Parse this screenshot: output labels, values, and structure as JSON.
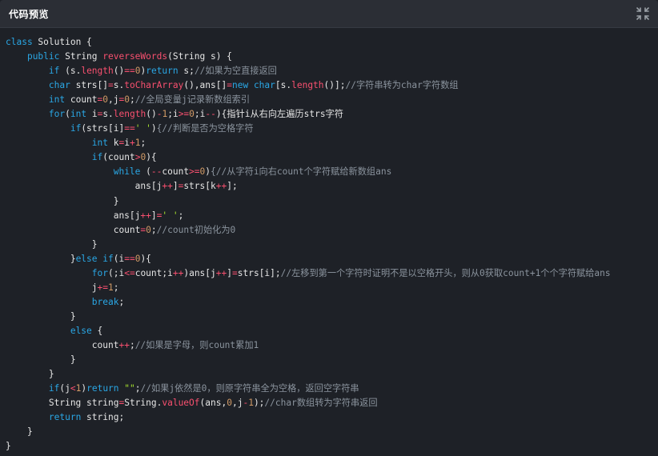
{
  "header": {
    "title": "代码预览",
    "collapse_icon": "collapse-icon"
  },
  "theme": {
    "background": "#1e2127",
    "titlebar": "#2b2e35",
    "keyword": "#2aa7e5",
    "function": "#f9506f",
    "number": "#d19a66",
    "string": "#a6e22e",
    "comment": "#8b949e",
    "text": "#e6e6e6"
  },
  "code": {
    "language": "java",
    "lines": [
      [
        [
          "kw",
          "class"
        ],
        [
          "tx",
          " Solution {"
        ]
      ],
      [
        [
          "tx",
          "    "
        ],
        [
          "kw",
          "public"
        ],
        [
          "tx",
          " String "
        ],
        [
          "fn",
          "reverseWords"
        ],
        [
          "tx",
          "(String s) {"
        ]
      ],
      [
        [
          "tx",
          "        "
        ],
        [
          "kw",
          "if"
        ],
        [
          "tx",
          " (s."
        ],
        [
          "fn",
          "length"
        ],
        [
          "tx",
          "()"
        ],
        [
          "op",
          "=="
        ],
        [
          "num",
          "0"
        ],
        [
          "tx",
          ")"
        ],
        [
          "kw",
          "return"
        ],
        [
          "tx",
          " s;"
        ],
        [
          "cm",
          "//如果为空直接返回"
        ]
      ],
      [
        [
          "tx",
          "        "
        ],
        [
          "kw",
          "char"
        ],
        [
          "tx",
          " strs[]"
        ],
        [
          "op",
          "="
        ],
        [
          "tx",
          "s."
        ],
        [
          "fn",
          "toCharArray"
        ],
        [
          "tx",
          "(),ans[]"
        ],
        [
          "op",
          "="
        ],
        [
          "kw",
          "new"
        ],
        [
          "tx",
          " "
        ],
        [
          "kw",
          "char"
        ],
        [
          "tx",
          "[s."
        ],
        [
          "fn",
          "length"
        ],
        [
          "tx",
          "()];"
        ],
        [
          "cm",
          "//字符串转为char字符数组"
        ]
      ],
      [
        [
          "tx",
          "        "
        ],
        [
          "kw",
          "int"
        ],
        [
          "tx",
          " count"
        ],
        [
          "op",
          "="
        ],
        [
          "num",
          "0"
        ],
        [
          "tx",
          ",j"
        ],
        [
          "op",
          "="
        ],
        [
          "num",
          "0"
        ],
        [
          "tx",
          ";"
        ],
        [
          "cm",
          "//全局变量j记录新数组索引"
        ]
      ],
      [
        [
          "tx",
          "        "
        ],
        [
          "kw",
          "for"
        ],
        [
          "tx",
          "("
        ],
        [
          "kw",
          "int"
        ],
        [
          "tx",
          " i"
        ],
        [
          "op",
          "="
        ],
        [
          "tx",
          "s."
        ],
        [
          "fn",
          "length"
        ],
        [
          "tx",
          "()"
        ],
        [
          "op",
          "-"
        ],
        [
          "num",
          "1"
        ],
        [
          "tx",
          ";i"
        ],
        [
          "op",
          ">="
        ],
        [
          "num",
          "0"
        ],
        [
          "tx",
          ";i"
        ],
        [
          "op",
          "--"
        ],
        [
          "tx",
          ")"
        ],
        [
          "tx",
          "{指针i从右向左遍历strs字符"
        ]
      ],
      [
        [
          "tx",
          "            "
        ],
        [
          "kw",
          "if"
        ],
        [
          "tx",
          "(strs[i]"
        ],
        [
          "op",
          "=="
        ],
        [
          "str",
          "' '"
        ],
        [
          "tx",
          ")"
        ],
        [
          "cm",
          "{//判断是否为空格字符"
        ]
      ],
      [
        [
          "tx",
          "                "
        ],
        [
          "kw",
          "int"
        ],
        [
          "tx",
          " k"
        ],
        [
          "op",
          "="
        ],
        [
          "tx",
          "i"
        ],
        [
          "op",
          "+"
        ],
        [
          "num",
          "1"
        ],
        [
          "tx",
          ";"
        ]
      ],
      [
        [
          "tx",
          "                "
        ],
        [
          "kw",
          "if"
        ],
        [
          "tx",
          "(count"
        ],
        [
          "op",
          ">"
        ],
        [
          "num",
          "0"
        ],
        [
          "tx",
          "){"
        ]
      ],
      [
        [
          "tx",
          "                    "
        ],
        [
          "kw",
          "while"
        ],
        [
          "tx",
          " ("
        ],
        [
          "op",
          "--"
        ],
        [
          "tx",
          "count"
        ],
        [
          "op",
          ">="
        ],
        [
          "num",
          "0"
        ],
        [
          "tx",
          ")"
        ],
        [
          "cm",
          "{//从字符i向右count个字符赋给新数组ans"
        ]
      ],
      [
        [
          "tx",
          "                        ans[j"
        ],
        [
          "op",
          "++"
        ],
        [
          "tx",
          "]"
        ],
        [
          "op",
          "="
        ],
        [
          "tx",
          "strs[k"
        ],
        [
          "op",
          "++"
        ],
        [
          "tx",
          "];"
        ]
      ],
      [
        [
          "tx",
          "                    }"
        ]
      ],
      [
        [
          "tx",
          "                    ans[j"
        ],
        [
          "op",
          "++"
        ],
        [
          "tx",
          "]"
        ],
        [
          "op",
          "="
        ],
        [
          "str",
          "' '"
        ],
        [
          "tx",
          ";"
        ]
      ],
      [
        [
          "tx",
          "                    count"
        ],
        [
          "op",
          "="
        ],
        [
          "num",
          "0"
        ],
        [
          "tx",
          ";"
        ],
        [
          "cm",
          "//count初始化为0"
        ]
      ],
      [
        [
          "tx",
          "                }"
        ]
      ],
      [
        [
          "tx",
          "            }"
        ],
        [
          "kw",
          "else if"
        ],
        [
          "tx",
          "(i"
        ],
        [
          "op",
          "=="
        ],
        [
          "num",
          "0"
        ],
        [
          "tx",
          "){"
        ]
      ],
      [
        [
          "tx",
          "                "
        ],
        [
          "kw",
          "for"
        ],
        [
          "tx",
          "(;i"
        ],
        [
          "op",
          "<="
        ],
        [
          "tx",
          "count;i"
        ],
        [
          "op",
          "++"
        ],
        [
          "tx",
          ")ans[j"
        ],
        [
          "op",
          "++"
        ],
        [
          "tx",
          "]"
        ],
        [
          "op",
          "="
        ],
        [
          "tx",
          "strs[i];"
        ],
        [
          "cm",
          "//左移到第一个字符时证明不是以空格开头，则从0获取count+1个个字符赋给ans"
        ]
      ],
      [
        [
          "tx",
          "                j"
        ],
        [
          "op",
          "+="
        ],
        [
          "num",
          "1"
        ],
        [
          "tx",
          ";"
        ]
      ],
      [
        [
          "tx",
          "                "
        ],
        [
          "kw",
          "break"
        ],
        [
          "tx",
          ";"
        ]
      ],
      [
        [
          "tx",
          "            }"
        ]
      ],
      [
        [
          "tx",
          "            "
        ],
        [
          "kw",
          "else"
        ],
        [
          "tx",
          " {"
        ]
      ],
      [
        [
          "tx",
          "                count"
        ],
        [
          "op",
          "++"
        ],
        [
          "tx",
          ";"
        ],
        [
          "cm",
          "//如果是字母，则count累加1"
        ]
      ],
      [
        [
          "tx",
          "            }"
        ]
      ],
      [
        [
          "tx",
          "        }"
        ]
      ],
      [
        [
          "tx",
          "        "
        ],
        [
          "kw",
          "if"
        ],
        [
          "tx",
          "(j"
        ],
        [
          "op",
          "<"
        ],
        [
          "num",
          "1"
        ],
        [
          "tx",
          ")"
        ],
        [
          "kw",
          "return"
        ],
        [
          "tx",
          " "
        ],
        [
          "str",
          "\"\""
        ],
        [
          "tx",
          ";"
        ],
        [
          "cm",
          "//如果j依然是0，则原字符串全为空格，返回空字符串"
        ]
      ],
      [
        [
          "tx",
          "        String string"
        ],
        [
          "op",
          "="
        ],
        [
          "tx",
          "String."
        ],
        [
          "fn",
          "valueOf"
        ],
        [
          "tx",
          "(ans,"
        ],
        [
          "num",
          "0"
        ],
        [
          "tx",
          ",j"
        ],
        [
          "op",
          "-"
        ],
        [
          "num",
          "1"
        ],
        [
          "tx",
          ");"
        ],
        [
          "cm",
          "//char数组转为字符串返回"
        ]
      ],
      [
        [
          "tx",
          "        "
        ],
        [
          "kw",
          "return"
        ],
        [
          "tx",
          " string;"
        ]
      ],
      [
        [
          "tx",
          "    }"
        ]
      ],
      [
        [
          "tx",
          "}"
        ]
      ]
    ]
  }
}
